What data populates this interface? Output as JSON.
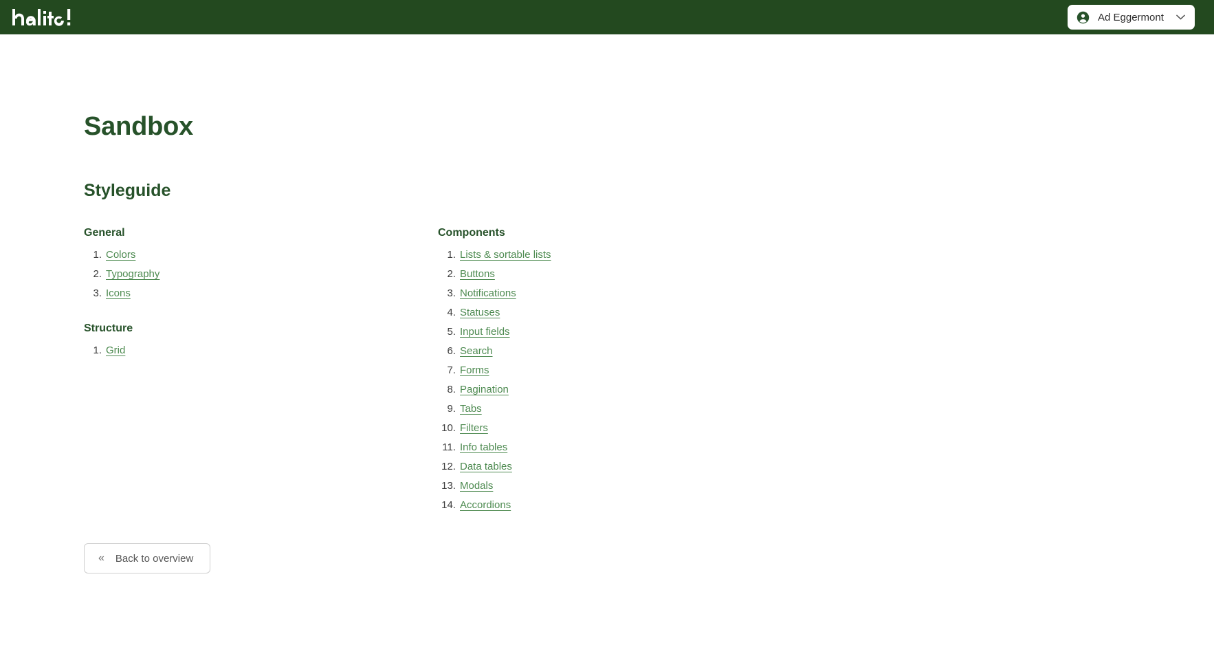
{
  "header": {
    "logo_text": "halito!",
    "logo_icon": "halito-wordmark",
    "user": {
      "name": "Ad Eggermont",
      "avatar_icon": "account-circle-icon",
      "chevron_icon": "chevron-down-icon"
    }
  },
  "page": {
    "title": "Sandbox",
    "section_title": "Styleguide"
  },
  "columns": {
    "general": {
      "heading": "General",
      "items": [
        {
          "label": "Colors"
        },
        {
          "label": "Typography"
        },
        {
          "label": "Icons"
        }
      ]
    },
    "structure": {
      "heading": "Structure",
      "items": [
        {
          "label": "Grid"
        }
      ]
    },
    "components": {
      "heading": "Components",
      "items": [
        {
          "label": "Lists & sortable lists"
        },
        {
          "label": "Buttons"
        },
        {
          "label": "Notifications"
        },
        {
          "label": "Statuses"
        },
        {
          "label": "Input fields"
        },
        {
          "label": "Search"
        },
        {
          "label": "Forms"
        },
        {
          "label": "Pagination"
        },
        {
          "label": "Tabs"
        },
        {
          "label": "Filters"
        },
        {
          "label": "Info tables"
        },
        {
          "label": "Data tables"
        },
        {
          "label": "Modals"
        },
        {
          "label": "Accordions"
        }
      ]
    }
  },
  "footer": {
    "back_button": {
      "label": "Back to overview",
      "icon": "double-chevron-left-icon",
      "icon_glyph": "«"
    }
  },
  "colors": {
    "header_bg": "#23491f",
    "heading": "#27522a",
    "link": "#4d8a50",
    "page_bg": "#ffffff",
    "button_border": "#cfcfcf",
    "button_text": "#555555"
  }
}
